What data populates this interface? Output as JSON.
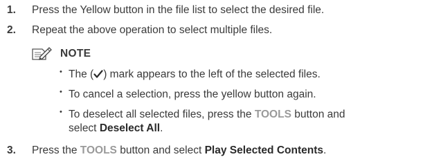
{
  "steps": [
    {
      "num": "1.",
      "text": "Press the Yellow button in the file list to select the desired file."
    },
    {
      "num": "2.",
      "text": "Repeat the above operation to select multiple files."
    },
    {
      "num": "3.",
      "pre": "Press the ",
      "kw1": "TOOLS",
      "mid": " button and select ",
      "kw2": "Play Selected Contents",
      "end": "."
    }
  ],
  "note": {
    "icon": "pencil-note-icon",
    "label": "NOTE",
    "bullet_glyph": "•",
    "bullets": [
      {
        "pre": "The (",
        "icon": "checkmark-icon",
        "post": ") mark appears to the left of the selected files."
      },
      {
        "text": "To cancel a selection, press the yellow button again."
      },
      {
        "pre": "To deselect all selected files, press the ",
        "kw1": "TOOLS",
        "mid": " button and",
        "line2_kw": "select ",
        "kw2": "Deselect All",
        "end": "."
      }
    ]
  }
}
